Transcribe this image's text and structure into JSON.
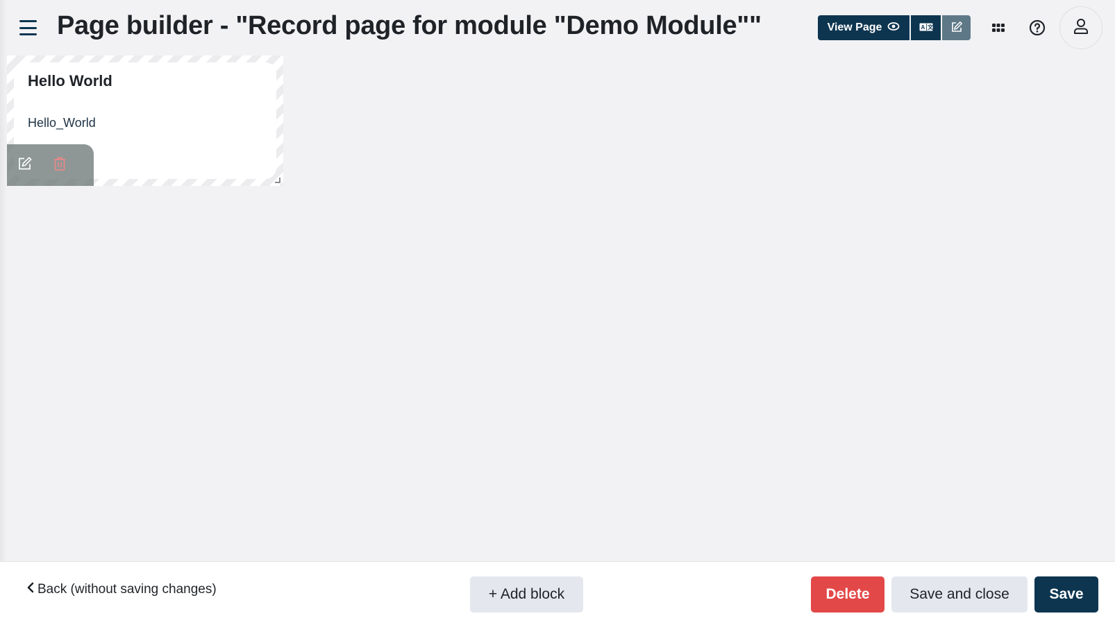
{
  "header": {
    "menu_icon": "hamburger-icon",
    "title": "Page builder - \"Record page for module \"Demo Module\"\"",
    "view_page_label": "View Page",
    "view_page_icon": "eye-icon",
    "translate_icon": "translate-icon",
    "edit_icon": "edit-icon",
    "apps_icon": "apps-grid-icon",
    "help_icon": "help-circle-icon",
    "profile_icon": "user-icon"
  },
  "canvas": {
    "blocks": [
      {
        "title": "Hello World",
        "content": "Hello_World",
        "edit_icon": "edit-icon",
        "delete_icon": "trash-icon"
      }
    ]
  },
  "footer": {
    "back_label": "Back (without saving changes)",
    "add_block_label": "+ Add block",
    "delete_label": "Delete",
    "save_and_close_label": "Save and close",
    "save_label": "Save"
  },
  "colors": {
    "primary": "#0d3550",
    "danger": "#e34849",
    "secondary": "#e4e8ee",
    "edit_active": "#5f7888",
    "background": "#f2f2f4"
  }
}
